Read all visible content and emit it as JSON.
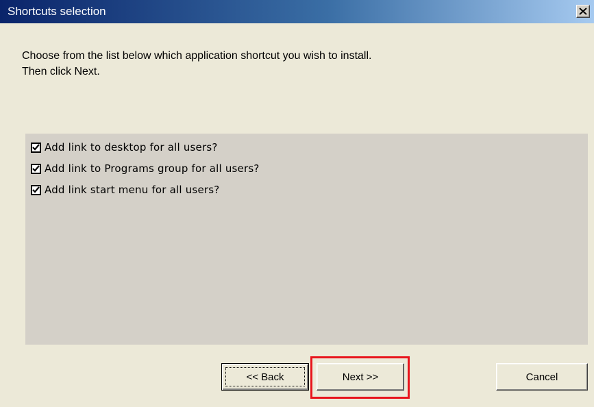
{
  "window": {
    "title": "Shortcuts selection",
    "close_symbol": "close-icon"
  },
  "instructions": {
    "line1": "Choose from the list below which application shortcut you wish to install.",
    "line2": "Then click Next."
  },
  "options": [
    {
      "label": "Add link to desktop for all users?",
      "checked": true
    },
    {
      "label": "Add link to Programs group for all users?",
      "checked": true
    },
    {
      "label": "Add link start menu for all users?",
      "checked": true
    }
  ],
  "buttons": {
    "back": "<< Back",
    "next": "Next >>",
    "cancel": "Cancel"
  },
  "colors": {
    "title_gradient_start": "#0a246a",
    "title_gradient_end": "#a6caf0",
    "dialog_bg": "#ece9d8",
    "list_bg": "#d4d0c8",
    "highlight": "#e8141c"
  }
}
